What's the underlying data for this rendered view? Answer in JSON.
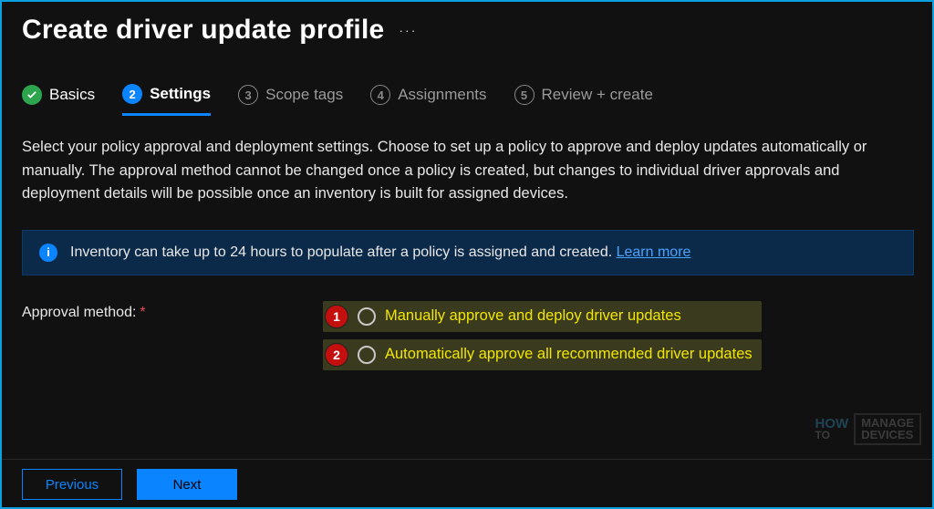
{
  "header": {
    "title": "Create driver update profile",
    "more": "···"
  },
  "tabs": [
    {
      "num": "✓",
      "label": "Basics",
      "state": "done"
    },
    {
      "num": "2",
      "label": "Settings",
      "state": "active"
    },
    {
      "num": "3",
      "label": "Scope tags",
      "state": "upcoming"
    },
    {
      "num": "4",
      "label": "Assignments",
      "state": "upcoming"
    },
    {
      "num": "5",
      "label": "Review + create",
      "state": "upcoming"
    }
  ],
  "description": "Select your policy approval and deployment settings. Choose to set up a policy to approve and deploy updates automatically or manually. The approval method cannot be changed once a policy is created, but changes to individual driver approvals and deployment details will be possible once an inventory is built for assigned devices.",
  "info": {
    "text": "Inventory can take up to 24 hours to populate after a policy is assigned and created. ",
    "link": "Learn more"
  },
  "form": {
    "approval_label": "Approval method:",
    "required_mark": "*",
    "options": [
      {
        "callout": "1",
        "label": "Manually approve and deploy driver updates"
      },
      {
        "callout": "2",
        "label": "Automatically approve all recommended driver updates"
      }
    ]
  },
  "footer": {
    "previous": "Previous",
    "next": "Next"
  },
  "watermark": {
    "how": "HOW",
    "to": "TO",
    "line1": "MANAGE",
    "line2": "DEVICES"
  }
}
